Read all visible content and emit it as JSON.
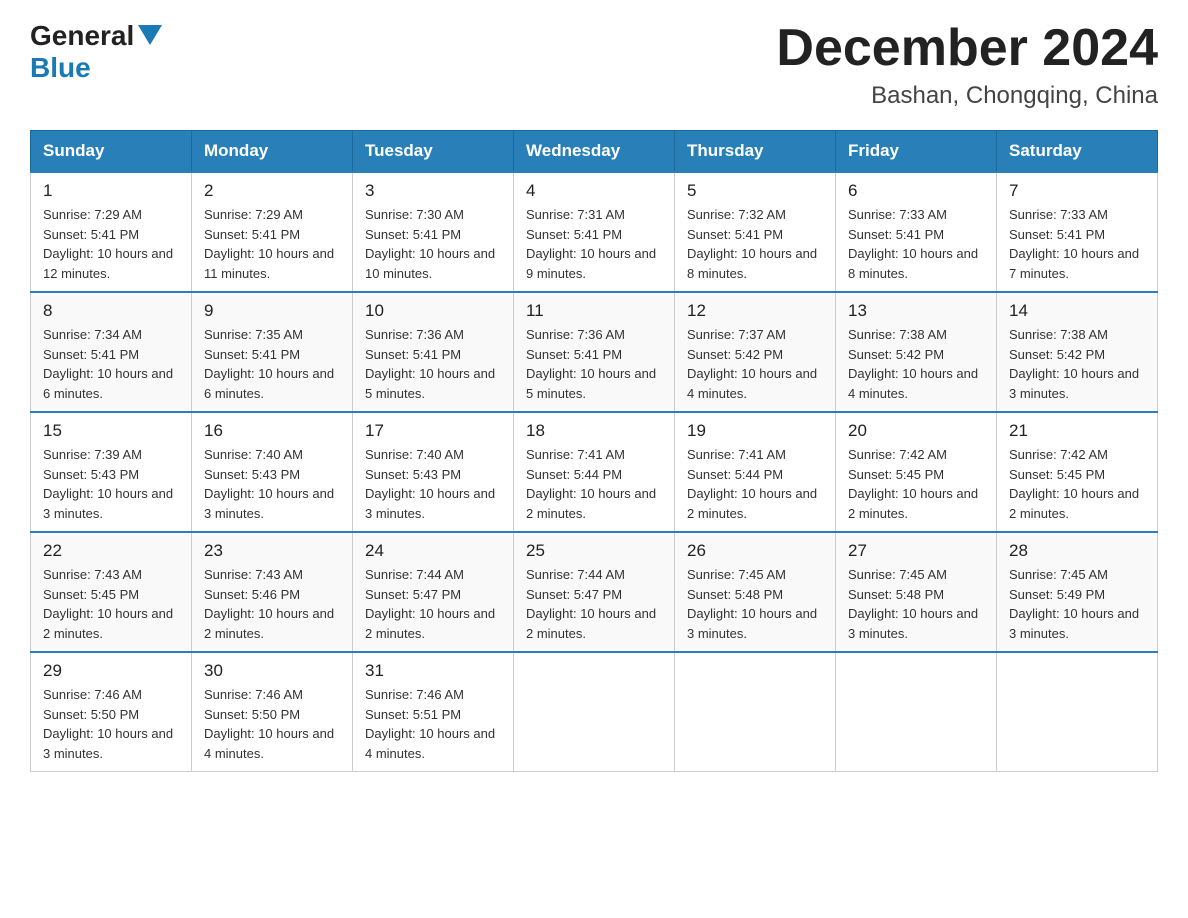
{
  "header": {
    "logo_text_general": "General",
    "logo_text_blue": "Blue",
    "month_title": "December 2024",
    "location": "Bashan, Chongqing, China"
  },
  "weekdays": [
    "Sunday",
    "Monday",
    "Tuesday",
    "Wednesday",
    "Thursday",
    "Friday",
    "Saturday"
  ],
  "weeks": [
    [
      {
        "day": "1",
        "sunrise": "7:29 AM",
        "sunset": "5:41 PM",
        "daylight": "10 hours and 12 minutes."
      },
      {
        "day": "2",
        "sunrise": "7:29 AM",
        "sunset": "5:41 PM",
        "daylight": "10 hours and 11 minutes."
      },
      {
        "day": "3",
        "sunrise": "7:30 AM",
        "sunset": "5:41 PM",
        "daylight": "10 hours and 10 minutes."
      },
      {
        "day": "4",
        "sunrise": "7:31 AM",
        "sunset": "5:41 PM",
        "daylight": "10 hours and 9 minutes."
      },
      {
        "day": "5",
        "sunrise": "7:32 AM",
        "sunset": "5:41 PM",
        "daylight": "10 hours and 8 minutes."
      },
      {
        "day": "6",
        "sunrise": "7:33 AM",
        "sunset": "5:41 PM",
        "daylight": "10 hours and 8 minutes."
      },
      {
        "day": "7",
        "sunrise": "7:33 AM",
        "sunset": "5:41 PM",
        "daylight": "10 hours and 7 minutes."
      }
    ],
    [
      {
        "day": "8",
        "sunrise": "7:34 AM",
        "sunset": "5:41 PM",
        "daylight": "10 hours and 6 minutes."
      },
      {
        "day": "9",
        "sunrise": "7:35 AM",
        "sunset": "5:41 PM",
        "daylight": "10 hours and 6 minutes."
      },
      {
        "day": "10",
        "sunrise": "7:36 AM",
        "sunset": "5:41 PM",
        "daylight": "10 hours and 5 minutes."
      },
      {
        "day": "11",
        "sunrise": "7:36 AM",
        "sunset": "5:41 PM",
        "daylight": "10 hours and 5 minutes."
      },
      {
        "day": "12",
        "sunrise": "7:37 AM",
        "sunset": "5:42 PM",
        "daylight": "10 hours and 4 minutes."
      },
      {
        "day": "13",
        "sunrise": "7:38 AM",
        "sunset": "5:42 PM",
        "daylight": "10 hours and 4 minutes."
      },
      {
        "day": "14",
        "sunrise": "7:38 AM",
        "sunset": "5:42 PM",
        "daylight": "10 hours and 3 minutes."
      }
    ],
    [
      {
        "day": "15",
        "sunrise": "7:39 AM",
        "sunset": "5:43 PM",
        "daylight": "10 hours and 3 minutes."
      },
      {
        "day": "16",
        "sunrise": "7:40 AM",
        "sunset": "5:43 PM",
        "daylight": "10 hours and 3 minutes."
      },
      {
        "day": "17",
        "sunrise": "7:40 AM",
        "sunset": "5:43 PM",
        "daylight": "10 hours and 3 minutes."
      },
      {
        "day": "18",
        "sunrise": "7:41 AM",
        "sunset": "5:44 PM",
        "daylight": "10 hours and 2 minutes."
      },
      {
        "day": "19",
        "sunrise": "7:41 AM",
        "sunset": "5:44 PM",
        "daylight": "10 hours and 2 minutes."
      },
      {
        "day": "20",
        "sunrise": "7:42 AM",
        "sunset": "5:45 PM",
        "daylight": "10 hours and 2 minutes."
      },
      {
        "day": "21",
        "sunrise": "7:42 AM",
        "sunset": "5:45 PM",
        "daylight": "10 hours and 2 minutes."
      }
    ],
    [
      {
        "day": "22",
        "sunrise": "7:43 AM",
        "sunset": "5:45 PM",
        "daylight": "10 hours and 2 minutes."
      },
      {
        "day": "23",
        "sunrise": "7:43 AM",
        "sunset": "5:46 PM",
        "daylight": "10 hours and 2 minutes."
      },
      {
        "day": "24",
        "sunrise": "7:44 AM",
        "sunset": "5:47 PM",
        "daylight": "10 hours and 2 minutes."
      },
      {
        "day": "25",
        "sunrise": "7:44 AM",
        "sunset": "5:47 PM",
        "daylight": "10 hours and 2 minutes."
      },
      {
        "day": "26",
        "sunrise": "7:45 AM",
        "sunset": "5:48 PM",
        "daylight": "10 hours and 3 minutes."
      },
      {
        "day": "27",
        "sunrise": "7:45 AM",
        "sunset": "5:48 PM",
        "daylight": "10 hours and 3 minutes."
      },
      {
        "day": "28",
        "sunrise": "7:45 AM",
        "sunset": "5:49 PM",
        "daylight": "10 hours and 3 minutes."
      }
    ],
    [
      {
        "day": "29",
        "sunrise": "7:46 AM",
        "sunset": "5:50 PM",
        "daylight": "10 hours and 3 minutes."
      },
      {
        "day": "30",
        "sunrise": "7:46 AM",
        "sunset": "5:50 PM",
        "daylight": "10 hours and 4 minutes."
      },
      {
        "day": "31",
        "sunrise": "7:46 AM",
        "sunset": "5:51 PM",
        "daylight": "10 hours and 4 minutes."
      },
      null,
      null,
      null,
      null
    ]
  ]
}
